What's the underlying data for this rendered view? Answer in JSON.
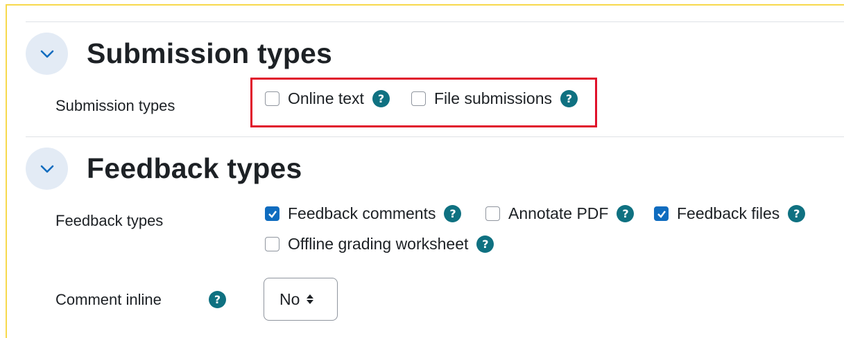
{
  "colors": {
    "accent": "#0f6cbf",
    "help": "#0f7181",
    "highlight": "#e0112b",
    "frame": "#f7d94c"
  },
  "submission_section": {
    "title": "Submission types",
    "toggle_icon": "chevron-down-icon",
    "row_label": "Submission types",
    "options": [
      {
        "label": "Online text",
        "checked": false
      },
      {
        "label": "File submissions",
        "checked": false
      }
    ]
  },
  "feedback_section": {
    "title": "Feedback types",
    "toggle_icon": "chevron-down-icon",
    "row_label": "Feedback types",
    "options": [
      {
        "label": "Feedback comments",
        "checked": true
      },
      {
        "label": "Annotate PDF",
        "checked": false
      },
      {
        "label": "Feedback files",
        "checked": true
      },
      {
        "label": "Offline grading worksheet",
        "checked": false
      }
    ]
  },
  "comment_inline": {
    "label": "Comment inline",
    "selected": "No"
  },
  "help_glyph": "?"
}
